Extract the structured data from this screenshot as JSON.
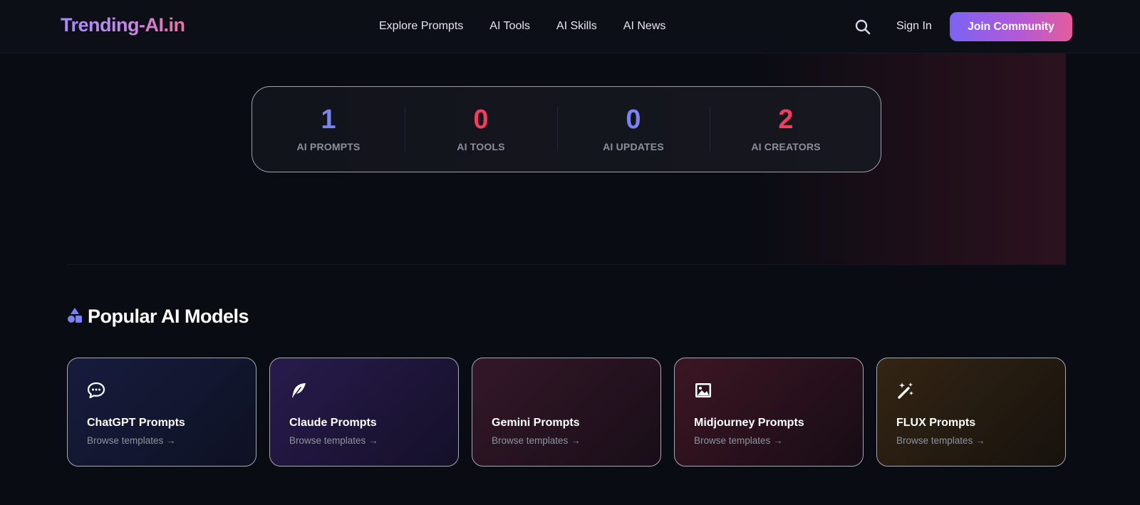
{
  "header": {
    "logo": "Trending-AI.in",
    "nav": [
      "Explore Prompts",
      "AI Tools",
      "AI Skills",
      "AI News"
    ],
    "sign_in": "Sign In",
    "join": "Join Community"
  },
  "stats": [
    {
      "value": "1",
      "label": "AI PROMPTS",
      "color": "#7b83f2"
    },
    {
      "value": "0",
      "label": "AI TOOLS",
      "color": "#ef3f5d"
    },
    {
      "value": "0",
      "label": "AI UPDATES",
      "color": "#7b83f2"
    },
    {
      "value": "2",
      "label": "AI CREATORS",
      "color": "#ef3f5d"
    }
  ],
  "popular": {
    "title": "Popular AI Models",
    "icon": "shapes-icon",
    "cards": [
      {
        "title": "ChatGPT Prompts",
        "sub": "Browse templates →",
        "icon": "chat-bubble-icon",
        "bg_from": "#151a3a",
        "bg_to": "#0d1020"
      },
      {
        "title": "Claude Prompts",
        "sub": "Browse templates →",
        "icon": "feather-icon",
        "bg_from": "#261a48",
        "bg_to": "#141028"
      },
      {
        "title": "Gemini Prompts",
        "sub": "Browse templates →",
        "icon": "none",
        "bg_from": "#321626",
        "bg_to": "#180e18"
      },
      {
        "title": "Midjourney Prompts",
        "sub": "Browse templates →",
        "icon": "image-icon",
        "bg_from": "#3a1622",
        "bg_to": "#180d16"
      },
      {
        "title": "FLUX Prompts",
        "sub": "Browse templates →",
        "icon": "magic-wand-icon",
        "bg_from": "#322414",
        "bg_to": "#17130e"
      }
    ]
  }
}
